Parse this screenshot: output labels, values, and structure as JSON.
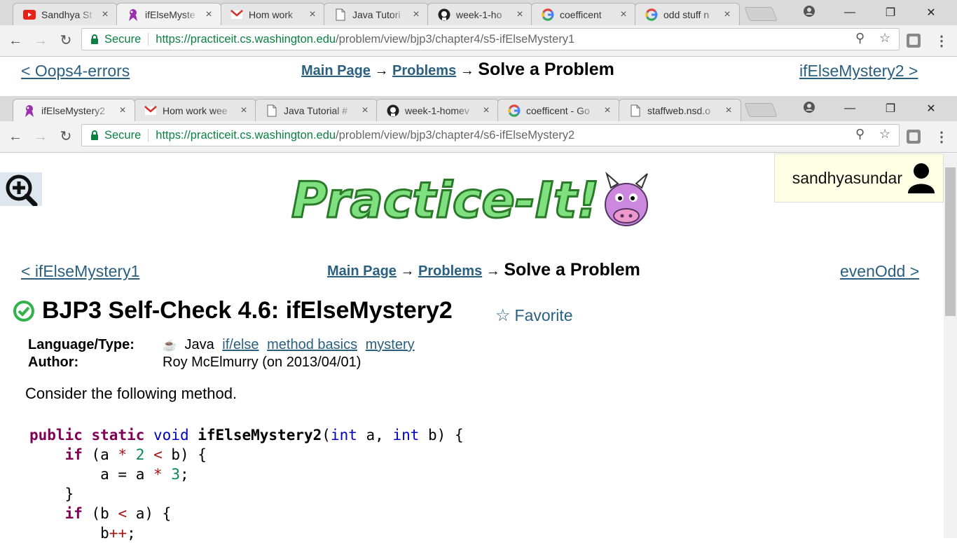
{
  "window1": {
    "tabs": [
      {
        "label": "Sandhya St",
        "icon": "youtube-icon",
        "active": false
      },
      {
        "label": "ifElseMyste",
        "icon": "practiceit-icon",
        "active": true
      },
      {
        "label": "Hom work",
        "icon": "gmail-icon",
        "active": false
      },
      {
        "label": "Java Tutori",
        "icon": "page-icon",
        "active": false
      },
      {
        "label": "week-1-ho",
        "icon": "github-icon",
        "active": false
      },
      {
        "label": "coefficent",
        "icon": "google-icon",
        "active": false
      },
      {
        "label": "odd stuff n",
        "icon": "google-icon",
        "active": false
      }
    ],
    "secure_label": "Secure",
    "url_host": "https://practiceit.cs.washington.edu",
    "url_path": "/problem/view/bjp3/chapter4/s5-ifElseMystery1",
    "nav": {
      "prev": "< Oops4-errors",
      "main": "Main Page",
      "problems": "Problems",
      "arrow": "→",
      "current": "Solve a Problem",
      "next": "ifElseMystery2 >"
    }
  },
  "window2": {
    "tabs": [
      {
        "label": "ifElseMystery2",
        "icon": "practiceit-icon",
        "active": true
      },
      {
        "label": "Hom work wee",
        "icon": "gmail-icon",
        "active": false
      },
      {
        "label": "Java Tutorial #",
        "icon": "page-icon",
        "active": false
      },
      {
        "label": "week-1-homev",
        "icon": "github-icon",
        "active": false
      },
      {
        "label": "coefficent - Go",
        "icon": "google-icon",
        "active": false
      },
      {
        "label": "staffweb.nsd.o",
        "icon": "page-icon",
        "active": false
      }
    ],
    "secure_label": "Secure",
    "url_host": "https://practiceit.cs.washington.edu",
    "url_path": "/problem/view/bjp3/chapter4/s6-ifElseMystery2",
    "nav": {
      "prev": "< ifElseMystery1",
      "main": "Main Page",
      "problems": "Problems",
      "arrow": "→",
      "current": "Solve a Problem",
      "next": "evenOdd >"
    }
  },
  "user": {
    "name": "sandhyasundar"
  },
  "problem": {
    "title": "BJP3 Self-Check 4.6: ifElseMystery2",
    "favorite_label": "Favorite",
    "language_label": "Language/Type:",
    "language": "Java",
    "tags": [
      "if/else",
      "method basics",
      "mystery"
    ],
    "author_label": "Author:",
    "author": "Roy McElmurry (on 2013/04/01)",
    "prompt": "Consider the following method."
  },
  "colors": {
    "link": "#2a5f7f",
    "secure_green": "#0b8043",
    "check_green": "#2fb34a",
    "keyword": "#7f0055",
    "type": "#0000c0",
    "userbox_bg": "#ffffe6"
  }
}
